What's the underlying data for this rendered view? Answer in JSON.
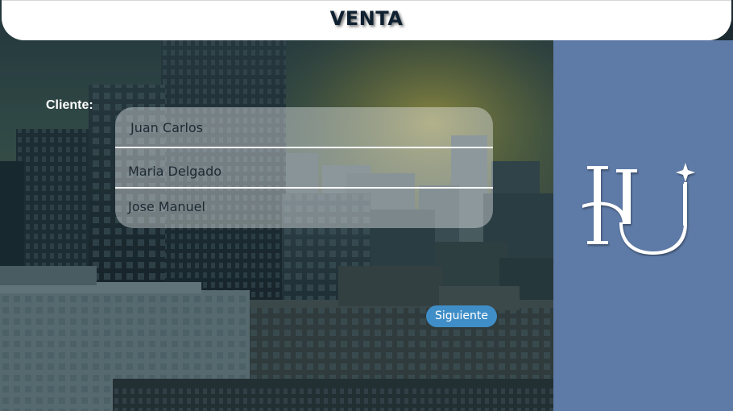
{
  "header": {
    "title": "VENTA"
  },
  "form": {
    "client_label": "Cliente:",
    "clients": [
      {
        "name": "Juan Carlos"
      },
      {
        "name": "Maria Delgado"
      },
      {
        "name": "Jose Manuel"
      }
    ],
    "next_label": "Siguiente"
  },
  "logo": {
    "icon": "hu-monogram-logo"
  },
  "colors": {
    "header_bg": "#ffffff",
    "title_text": "#0f2030",
    "side_panel": "#5e7aa6",
    "button": "#3f8ec8",
    "button_text": "#ffffff",
    "list_bg": "rgba(235,238,240,0.42)"
  }
}
